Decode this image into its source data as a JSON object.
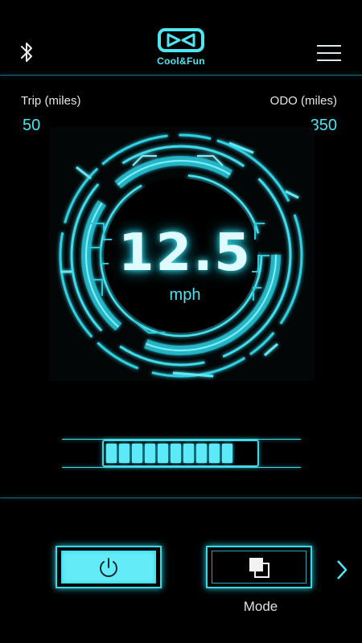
{
  "header": {
    "logo_text": "Cool&Fun",
    "bluetooth_icon": "bluetooth-icon",
    "menu_icon": "hamburger-menu-icon"
  },
  "stats": {
    "trip_label": "Trip (miles)",
    "trip_value": "50",
    "odo_label": "ODO (miles)",
    "odo_value": "350"
  },
  "speedometer": {
    "speed": "12.5",
    "unit": "mph"
  },
  "battery": {
    "segments_filled": 10,
    "segments_total": 10
  },
  "controls": {
    "power_icon": "power-icon",
    "mode_icon": "mode-icon",
    "mode_label": "Mode",
    "next_icon": "chevron-right-icon"
  },
  "colors": {
    "accent": "#48e6f5",
    "background": "#000000",
    "glow": "#38e0f0"
  }
}
